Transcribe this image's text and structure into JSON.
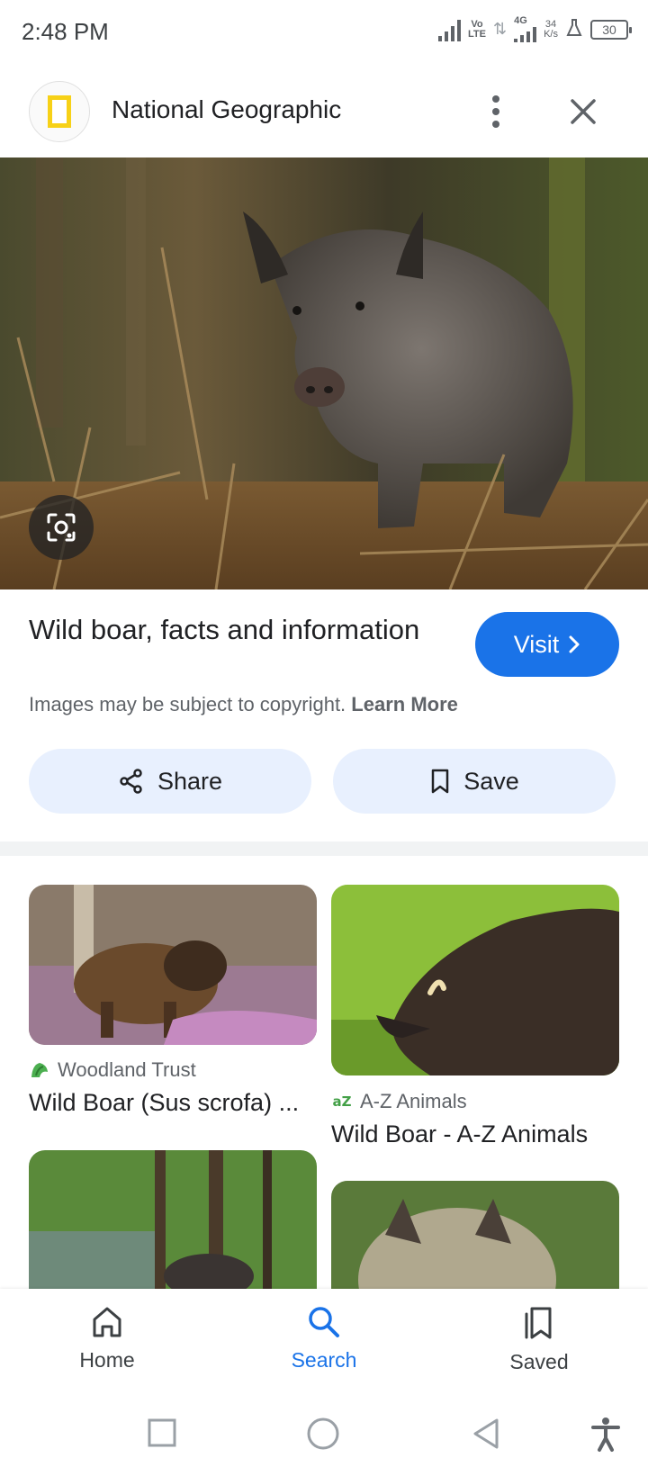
{
  "status": {
    "time": "2:48 PM",
    "volte_top": "Vo",
    "volte_bottom": "LTE",
    "net_type": "4G",
    "speed_value": "34",
    "speed_unit": "K/s",
    "battery": "30"
  },
  "header": {
    "site_name": "National Geographic"
  },
  "result": {
    "title": "Wild boar, facts and information",
    "visit_label": "Visit",
    "copyright_text": "Images may be subject to copyright.",
    "learn_more": "Learn More",
    "share_label": "Share",
    "save_label": "Save"
  },
  "related": [
    {
      "source": "Woodland Trust",
      "title": "Wild Boar (Sus scrofa) ..."
    },
    {
      "source": "A-Z Animals",
      "title": "Wild Boar - A-Z Animals"
    }
  ],
  "nav": {
    "home": "Home",
    "search": "Search",
    "saved": "Saved"
  },
  "colors": {
    "accent": "#1a73e8",
    "chip_bg": "#e8f0fe",
    "natgeo_yellow": "#f7d117"
  }
}
